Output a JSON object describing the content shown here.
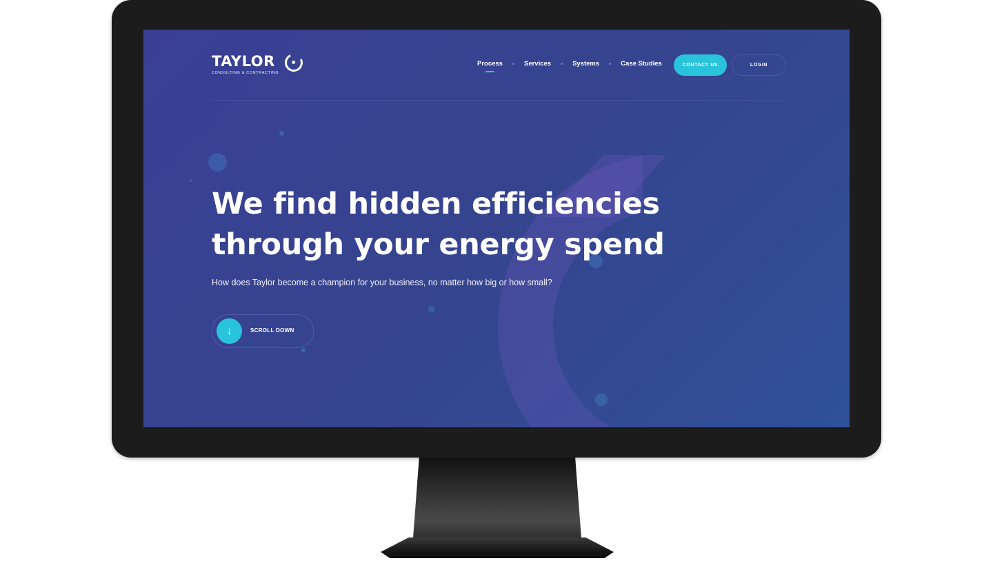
{
  "brand": {
    "name": "TAYLOR",
    "tagline": "CONSULTING & CONTRACTING"
  },
  "nav": {
    "items": [
      {
        "label": "Process",
        "active": true
      },
      {
        "label": "Services",
        "active": false
      },
      {
        "label": "Systems",
        "active": false
      },
      {
        "label": "Case Studies",
        "active": false
      }
    ],
    "contact_label": "CONTACT US",
    "login_label": "LOGIN"
  },
  "hero": {
    "title": "We find hidden efficiencies through your energy spend",
    "subtitle": "How does Taylor become a champion for your business, no matter how big or how small?",
    "scroll_label": "SCROLL DOWN",
    "scroll_icon": "↓"
  },
  "colors": {
    "background": "#37438f",
    "accent": "#29c3dc",
    "bezel": "#1c1c1c"
  }
}
